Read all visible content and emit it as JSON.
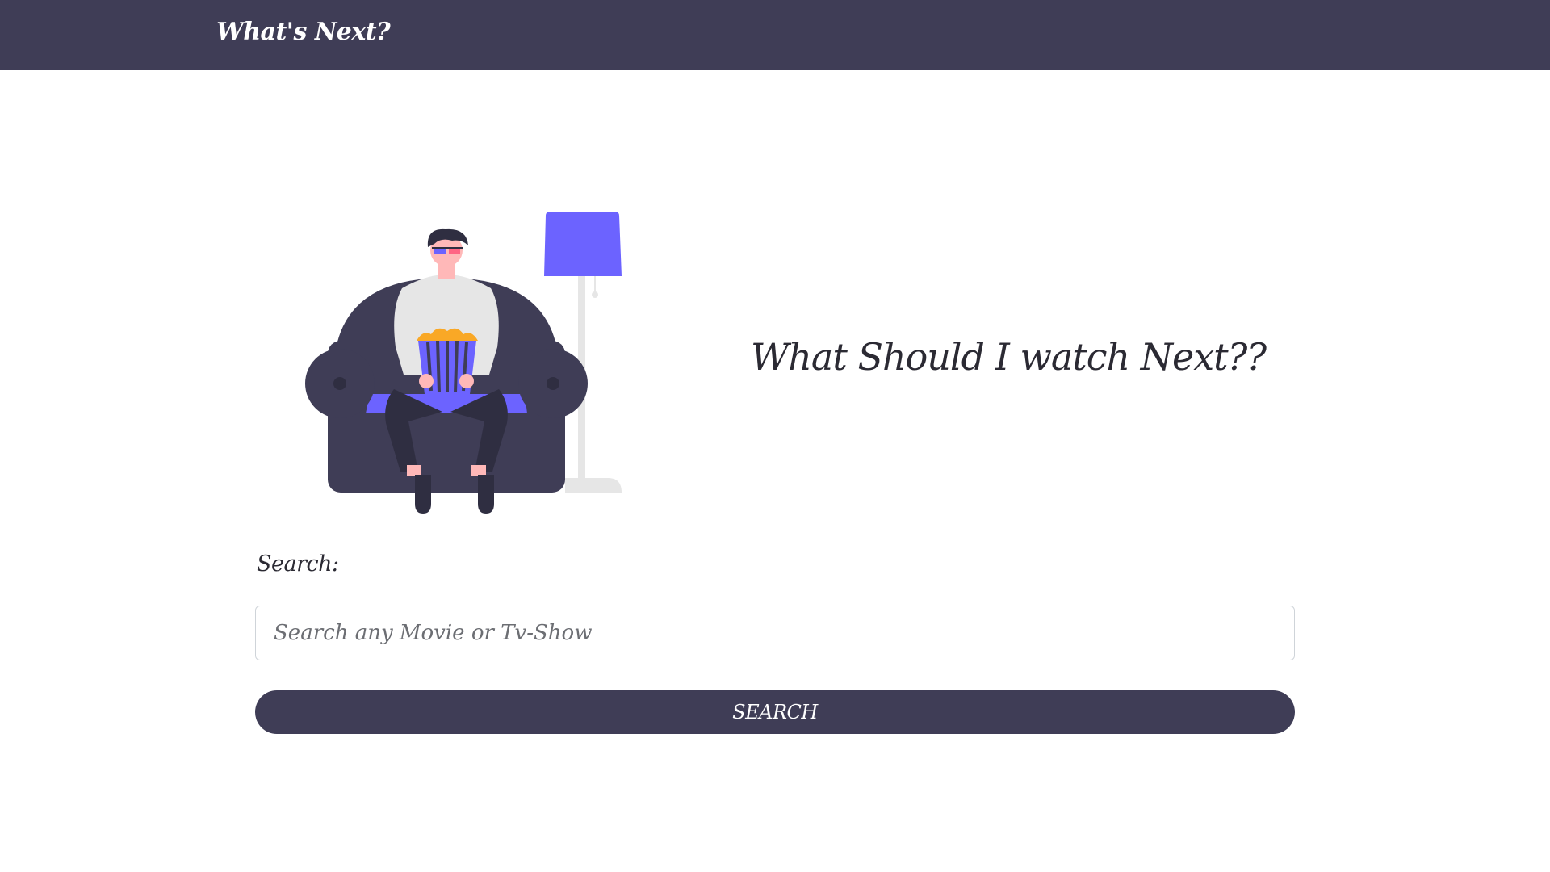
{
  "navbar": {
    "brand": "What's Next?"
  },
  "hero": {
    "title": "What Should I watch Next??",
    "illustration": "person-on-couch-with-popcorn-illustration"
  },
  "search": {
    "label": "Search:",
    "placeholder": "Search any Movie or Tv-Show",
    "value": "",
    "button_label": "SEARCH"
  },
  "colors": {
    "navbar": "#3f3d56",
    "accent": "#6c63ff",
    "button": "#3f3d56",
    "text": "#2b2a33"
  }
}
